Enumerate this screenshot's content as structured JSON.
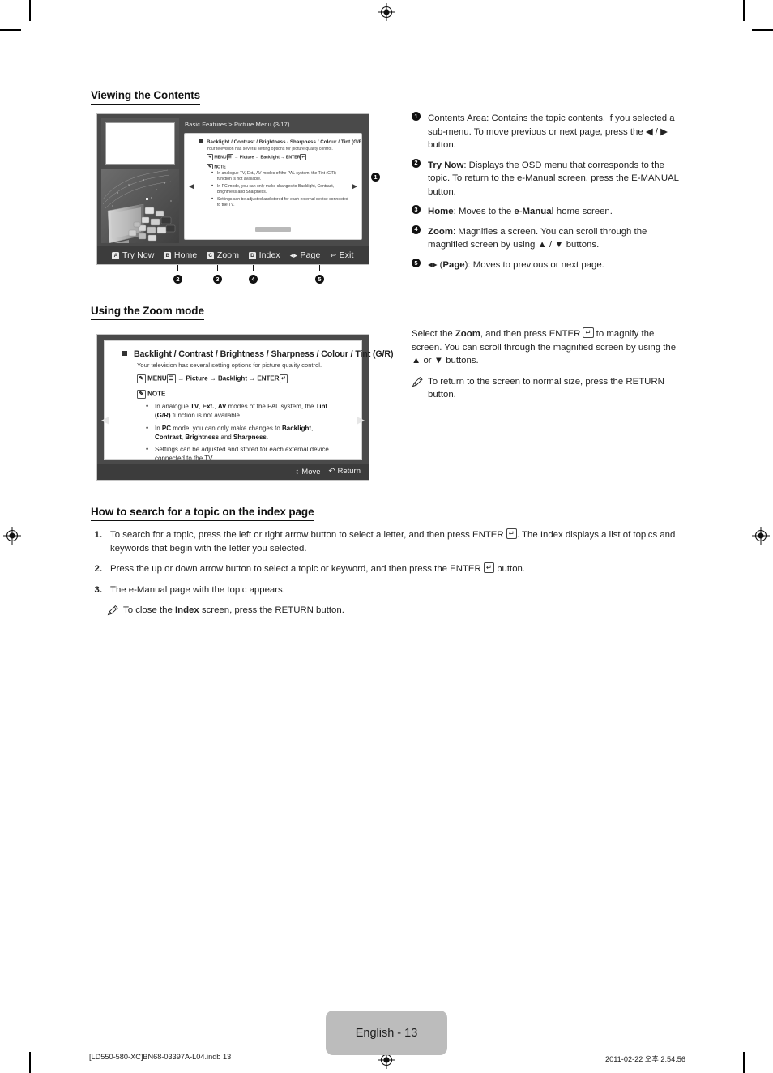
{
  "document": {
    "page_label": "English - 13",
    "footer_left": "[LD550-580-XC]BN68-03397A-L04.indb   13",
    "footer_right": "2011-02-22  오후 2:54:56"
  },
  "sections": {
    "viewing": {
      "heading": "Viewing the Contents"
    },
    "zoom_mode": {
      "heading": "Using the Zoom mode"
    },
    "index_search": {
      "heading": "How to search for a topic on the index page"
    }
  },
  "tv_screen": {
    "breadcrumb": "Basic Features > Picture Menu (3/17)",
    "topic": {
      "title": "Backlight / Contrast / Brightness / Sharpness / Colour / Tint (G/R)",
      "subtitle": "Your television has several setting options for picture quality control.",
      "menu_path_prefix": "MENU",
      "menu_path": "→ Picture → Backlight → ENTER",
      "note_label": "NOTE",
      "notes": [
        "In analogue TV, Ext., AV modes of the PAL system, the Tint (G/R) function is not available.",
        "In PC mode, you can only make changes to Backlight, Contrast, Brightness and Sharpness.",
        "Settings can be adjusted and stored for each external device connected to the TV."
      ]
    },
    "arrow_left": "◀",
    "arrow_right": "▶",
    "bottom_bar": [
      {
        "key": "A",
        "label": "Try Now"
      },
      {
        "key": "B",
        "label": "Home"
      },
      {
        "key": "C",
        "label": "Zoom"
      },
      {
        "key": "D",
        "label": "Index"
      },
      {
        "key": "◂▸",
        "label": "Page"
      },
      {
        "key": "↩",
        "label": "Exit"
      }
    ]
  },
  "callouts": {
    "one": "❶",
    "two": "❷",
    "three": "❸",
    "four": "❹",
    "five": "❺"
  },
  "legend": [
    {
      "num": "1",
      "html": "Contents Area: Contains the topic contents, if you selected a sub-menu. To move previous or next page, press the ◀ / ▶ button."
    },
    {
      "num": "2",
      "html": "<b>Try Now</b>: Displays the OSD menu that corresponds to the topic. To return to the e-Manual screen, press the E-MANUAL button."
    },
    {
      "num": "3",
      "html": "<b>Home</b>: Moves to the <b>e-Manual</b> home screen."
    },
    {
      "num": "4",
      "html": "<b>Zoom</b>: Magnifies a screen. You can scroll through the magnified screen by using ▲ / ▼ buttons."
    },
    {
      "num": "5",
      "html": "◂▸ (<b>Page</b>): Moves to previous or next page."
    }
  ],
  "zoom_panel": {
    "title": "Backlight / Contrast / Brightness / Sharpness / Colour / Tint (G/R)",
    "subtitle": "Your television has several setting options for picture quality control.",
    "menu_prefix": "MENU",
    "menu_path": "→ Picture → Backlight → ENTER",
    "note_label": "NOTE",
    "notes": [
      "In analogue <b>TV</b>, <b>Ext.</b>, <b>AV</b> modes of the PAL system, the <b>Tint (G/R)</b> function is not available.",
      "In <b>PC</b> mode, you can only make changes to <b>Backlight</b>, <b>Contrast</b>, <b>Brightness</b> and <b>Sharpness</b>.",
      "Settings can be adjusted and stored for each external device connected to the TV."
    ],
    "arrow_left": "◀",
    "arrow_right": "▶",
    "bottom_bar": [
      {
        "icon": "↕",
        "label": "Move"
      },
      {
        "icon": "↶",
        "label": "Return"
      }
    ]
  },
  "zoom_text": {
    "body_html": "Select the <b>Zoom</b>, and then press ENTER <span class=\"ekey\">↵</span> to magnify the screen. You can scroll through the magnified screen by using the ▲ or ▼ buttons.",
    "note_html": "To return to the screen to normal size, press the RETURN button."
  },
  "index_steps": [
    {
      "num": "1.",
      "html": "To search for a topic, press the left or right arrow button to select a letter, and then press ENTER <span class=\"ekey\">↵</span>. The Index displays a list of topics and keywords that begin with the letter you selected."
    },
    {
      "num": "2.",
      "html": "Press the up or down arrow button to select a topic or keyword, and then press the ENTER <span class=\"ekey\">↵</span> button."
    },
    {
      "num": "3.",
      "html": "The e-Manual page with the topic appears."
    }
  ],
  "index_note": {
    "html": "To close the <b>Index</b> screen, press the RETURN button."
  },
  "colors": {
    "tv_chrome": "#4a4a4a",
    "tv_bar": "#3c3c3c",
    "page_tab": "#bcbcbc",
    "text": "#1a1a1a"
  }
}
